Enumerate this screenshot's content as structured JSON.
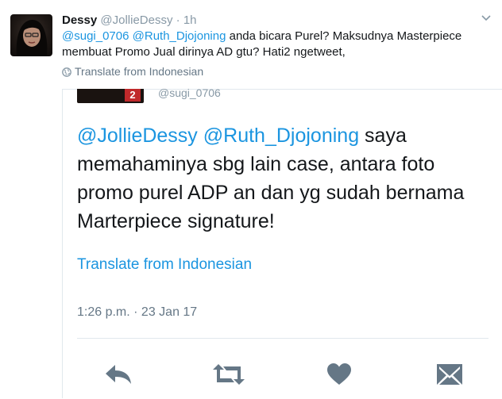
{
  "tweet": {
    "author_name": "Dessy",
    "author_handle": "@JollieDessy",
    "separator": "·",
    "time": "1h",
    "mention1": "@sugi_0706",
    "mention2": "@Ruth_Djojoning",
    "text_rest": " anda bicara Purel?  Maksudnya Masterpiece membuat Promo Jual dirinya AD gtu?  Hati2 ngetweet,",
    "translate_label": "Translate from Indonesian"
  },
  "quoted": {
    "handle_partial": "@sugi_0706",
    "badge": "2",
    "mention1": "@JollieDessy",
    "mention2": "@Ruth_Djojoning",
    "text_rest": " saya memahaminya sbg lain case, antara foto promo purel ADP an dan yg sudah bernama Marterpiece signature!",
    "translate_label": "Translate from Indonesian",
    "timestamp": "1:26 p.m. · 23 Jan 17"
  },
  "icons": {
    "caret": "chevron-down-icon",
    "globe": "globe-icon",
    "reply": "reply-icon",
    "retweet": "retweet-icon",
    "like": "heart-icon",
    "dm": "envelope-icon"
  },
  "colors": {
    "link": "#1b95e0",
    "muted": "#8899a6",
    "icon": "#657786"
  }
}
